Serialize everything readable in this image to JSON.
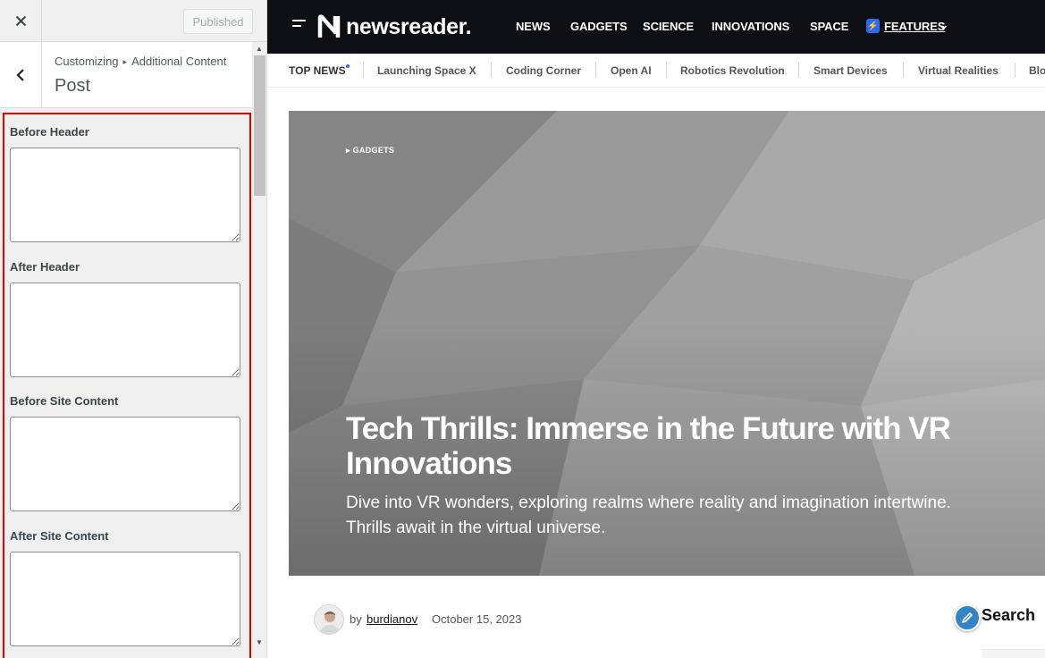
{
  "customizer": {
    "published_label": "Published",
    "breadcrumb_root": "Customizing",
    "breadcrumb_section": "Additional Content",
    "panel_title": "Post",
    "fields": [
      {
        "label": "Before Header",
        "value": ""
      },
      {
        "label": "After Header",
        "value": ""
      },
      {
        "label": "Before Site Content",
        "value": ""
      },
      {
        "label": "After Site Content",
        "value": ""
      }
    ]
  },
  "site": {
    "logo": "newsreader.",
    "nav": [
      "NEWS",
      "GADGETS",
      "SCIENCE",
      "INNOVATIONS",
      "SPACE",
      "FEATURES"
    ],
    "trending_title": "TOP NEWS",
    "trending": [
      "Launching Space X",
      "Coding Corner",
      "Open AI",
      "Robotics Revolution",
      "Smart Devices",
      "Virtual Realities",
      "Blo"
    ],
    "accent_color": "#2a6bf2",
    "article": {
      "category": "▸ GADGETS",
      "title": "Tech Thrills: Immerse in the Future with VR Innovations",
      "subtitle": "Dive into VR wonders, exploring realms where reality and imagination intertwine. Thrills await in the virtual universe.",
      "by": "by",
      "author": "burdianov",
      "date": "October 15, 2023"
    },
    "sidebar_widget_title": "Search"
  },
  "icons": {
    "close": "close-icon",
    "back": "chevron-left-icon",
    "menu": "hamburger-menu-icon",
    "features": "lightning-bolt-icon",
    "dropdown": "chevron-down-icon",
    "edit": "pencil-icon"
  }
}
